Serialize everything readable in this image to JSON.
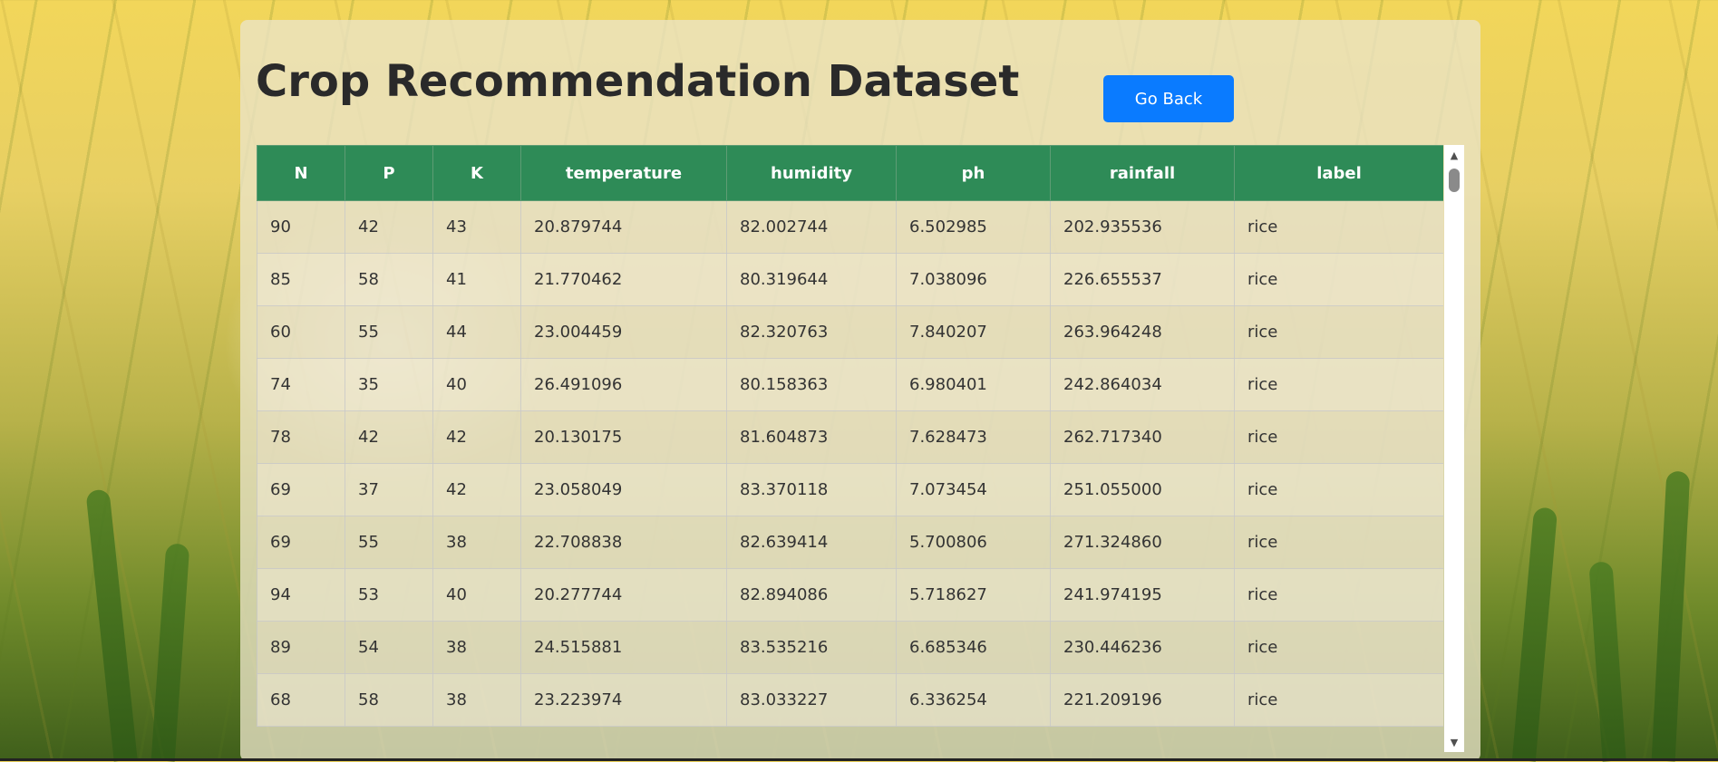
{
  "page": {
    "title": "Crop Recommendation Dataset",
    "back_button_label": "Go Back"
  },
  "table": {
    "columns": [
      "N",
      "P",
      "K",
      "temperature",
      "humidity",
      "ph",
      "rainfall",
      "label"
    ],
    "rows": [
      [
        "90",
        "42",
        "43",
        "20.879744",
        "82.002744",
        "6.502985",
        "202.935536",
        "rice"
      ],
      [
        "85",
        "58",
        "41",
        "21.770462",
        "80.319644",
        "7.038096",
        "226.655537",
        "rice"
      ],
      [
        "60",
        "55",
        "44",
        "23.004459",
        "82.320763",
        "7.840207",
        "263.964248",
        "rice"
      ],
      [
        "74",
        "35",
        "40",
        "26.491096",
        "80.158363",
        "6.980401",
        "242.864034",
        "rice"
      ],
      [
        "78",
        "42",
        "42",
        "20.130175",
        "81.604873",
        "7.628473",
        "262.717340",
        "rice"
      ],
      [
        "69",
        "37",
        "42",
        "23.058049",
        "83.370118",
        "7.073454",
        "251.055000",
        "rice"
      ],
      [
        "69",
        "55",
        "38",
        "22.708838",
        "82.639414",
        "5.700806",
        "271.324860",
        "rice"
      ],
      [
        "94",
        "53",
        "40",
        "20.277744",
        "82.894086",
        "5.718627",
        "241.974195",
        "rice"
      ],
      [
        "89",
        "54",
        "38",
        "24.515881",
        "83.535216",
        "6.685346",
        "230.446236",
        "rice"
      ],
      [
        "68",
        "58",
        "38",
        "23.223974",
        "83.033227",
        "6.336254",
        "221.209196",
        "rice"
      ]
    ]
  },
  "colors": {
    "header_bg": "#2e8b57",
    "button_bg": "#0a7bff"
  },
  "icons": {
    "scroll_up": "▲",
    "scroll_down": "▼"
  }
}
